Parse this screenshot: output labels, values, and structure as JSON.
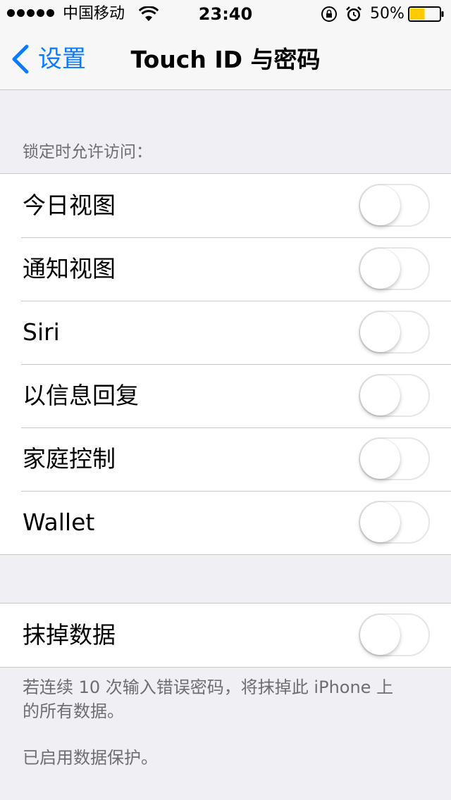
{
  "status_bar": {
    "carrier": "中国移动",
    "time": "23:40",
    "battery_percent": "50%",
    "battery_level": 0.5,
    "signal_bars": 5,
    "icons": [
      "signal-dots-icon",
      "wifi-icon",
      "orientation-lock-icon",
      "alarm-icon",
      "battery-icon"
    ]
  },
  "nav": {
    "back_label": "设置",
    "title": "Touch ID 与密码"
  },
  "lock_access": {
    "header": "锁定时允许访问：",
    "items": [
      {
        "label": "今日视图",
        "on": false
      },
      {
        "label": "通知视图",
        "on": false
      },
      {
        "label": "Siri",
        "on": false
      },
      {
        "label": "以信息回复",
        "on": false
      },
      {
        "label": "家庭控制",
        "on": false
      },
      {
        "label": "Wallet",
        "on": false
      }
    ]
  },
  "erase": {
    "label": "抹掉数据",
    "on": false,
    "footer_line1": "若连续 10 次输入错误密码，将抹掉此 iPhone 上",
    "footer_line2": "的所有数据。",
    "footer_protection": "已启用数据保护。"
  },
  "colors": {
    "accent": "#0a7aff",
    "background": "#efeff4",
    "separator": "#c8c7cc",
    "battery_fill": "#fecb00",
    "secondary_text": "#6d6d72"
  }
}
